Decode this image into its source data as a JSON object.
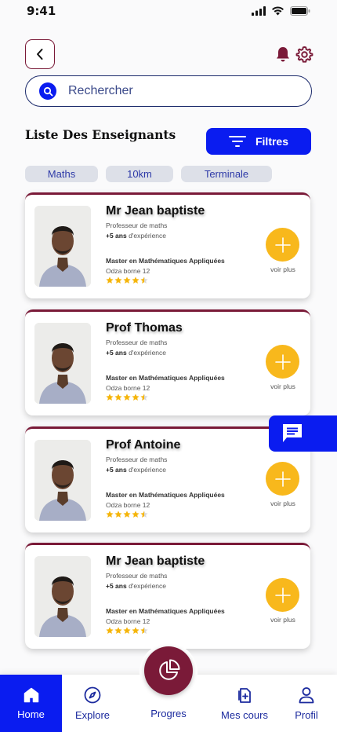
{
  "status_bar": {
    "time": "9:41"
  },
  "header": {
    "back_icon": "chevron-left-icon",
    "notification_icon": "bell-icon",
    "settings_icon": "gear-icon"
  },
  "search": {
    "placeholder": "Rechercher",
    "value": ""
  },
  "list": {
    "title": "Liste Des Enseignants",
    "filter_label": "Filtres"
  },
  "chips": [
    {
      "label": "Maths"
    },
    {
      "label": "10km"
    },
    {
      "label": "Terminale"
    }
  ],
  "teachers": [
    {
      "name": "Mr Jean baptiste",
      "role": "Professeur de maths",
      "experience_value": "+5 ans",
      "experience_suffix": " d'expérience",
      "degree": "Master en Mathématiques Appliquées",
      "location": "Odza borne 12",
      "rating": 4.5,
      "more_label": "voir plus"
    },
    {
      "name": "Prof Thomas",
      "role": "Professeur de maths",
      "experience_value": "+5 ans",
      "experience_suffix": " d'expérience",
      "degree": "Master en Mathématiques Appliquées",
      "location": "Odza borne 12",
      "rating": 4.5,
      "more_label": "voir plus"
    },
    {
      "name": "Prof Antoine",
      "role": "Professeur de maths",
      "experience_value": "+5 ans",
      "experience_suffix": " d'expérience",
      "degree": "Master en Mathématiques Appliquées",
      "location": "Odza borne 12",
      "rating": 4.5,
      "more_label": "voir plus"
    },
    {
      "name": "Mr Jean baptiste",
      "role": "Professeur de maths",
      "experience_value": "+5 ans",
      "experience_suffix": " d'expérience",
      "degree": "Master en Mathématiques Appliquées",
      "location": "Odza borne 12",
      "rating": 4.5,
      "more_label": "voir plus"
    }
  ],
  "nav": {
    "items": [
      {
        "label": "Home",
        "icon": "home-icon",
        "active": true
      },
      {
        "label": "Explore",
        "icon": "compass-icon",
        "active": false
      },
      {
        "label": "Progres",
        "icon": "pie-chart-icon",
        "active": false
      },
      {
        "label": "Mes cours",
        "icon": "add-document-icon",
        "active": false
      },
      {
        "label": "Profil",
        "icon": "user-icon",
        "active": false
      }
    ]
  },
  "colors": {
    "primary_blue": "#0a1cf0",
    "maroon": "#7a1a38",
    "accent_yellow": "#f8b81c",
    "star": "#f5b50a"
  }
}
